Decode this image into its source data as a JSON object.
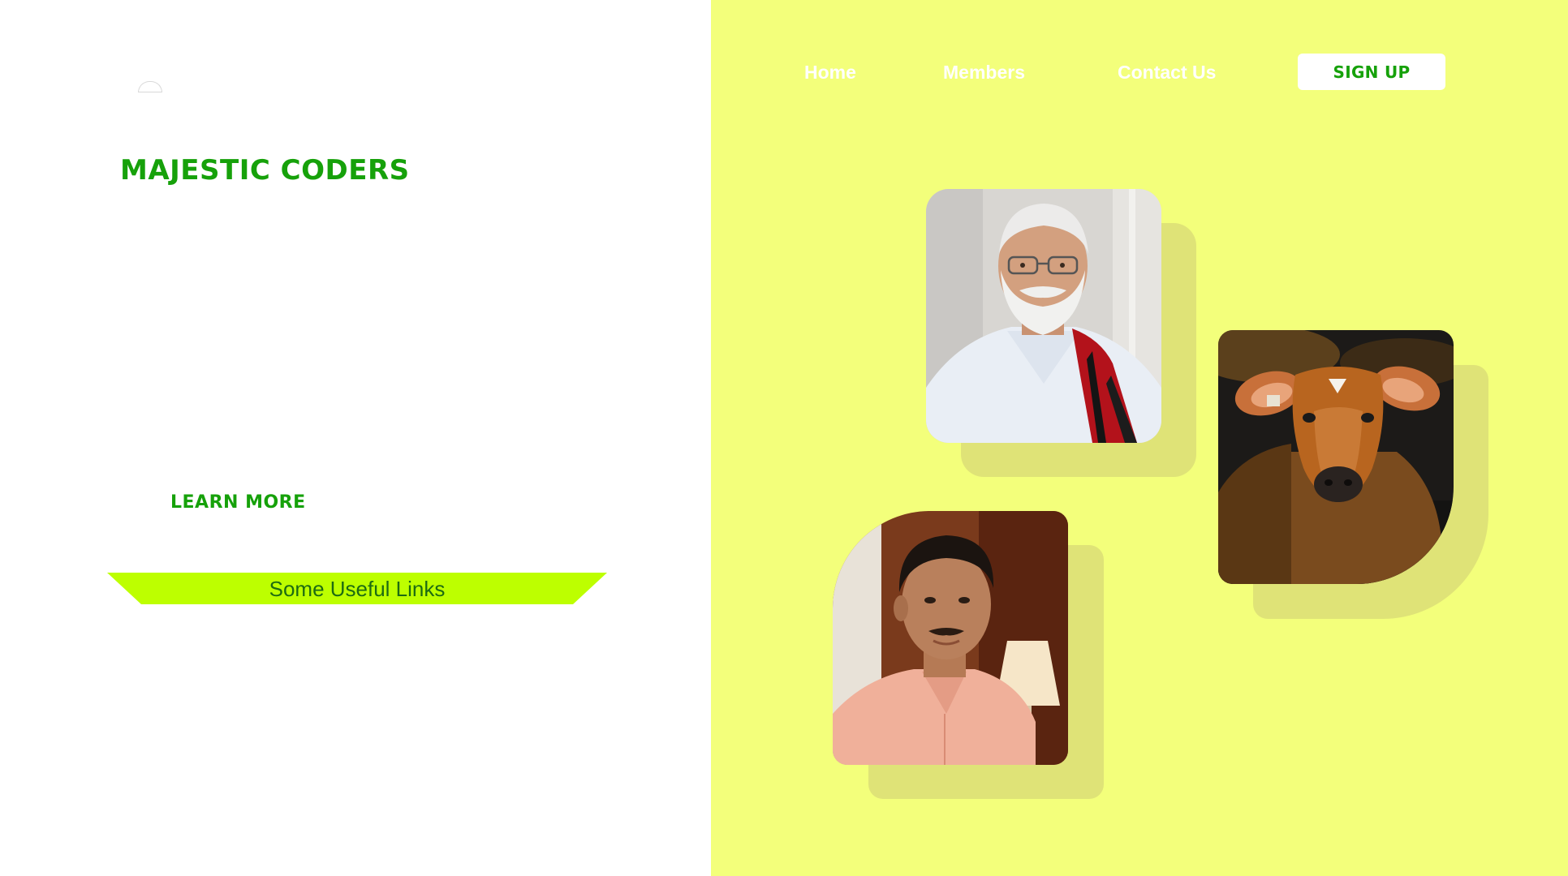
{
  "brand": {
    "logo_icon": "arc-logo-icon",
    "title": "MAJESTIC CODERS"
  },
  "hero": {
    "cta_label": "LEARN MORE"
  },
  "links_banner": {
    "label": "Some Useful Links"
  },
  "nav": {
    "items": [
      {
        "label": "Home"
      },
      {
        "label": "Members"
      },
      {
        "label": "Contact Us"
      }
    ],
    "signup_label": "SIGN UP"
  },
  "gallery": {
    "cards": [
      {
        "subject": "man-with-white-beard-and-glasses"
      },
      {
        "subject": "brown-calf"
      },
      {
        "subject": "man-in-pink-shirt"
      }
    ]
  },
  "colors": {
    "left_bg": "#ffffff",
    "right_bg": "#f3ff7b",
    "brand_green": "#16a10a",
    "banner_green": "#bdff00",
    "card_shadow": "#dfe377"
  }
}
